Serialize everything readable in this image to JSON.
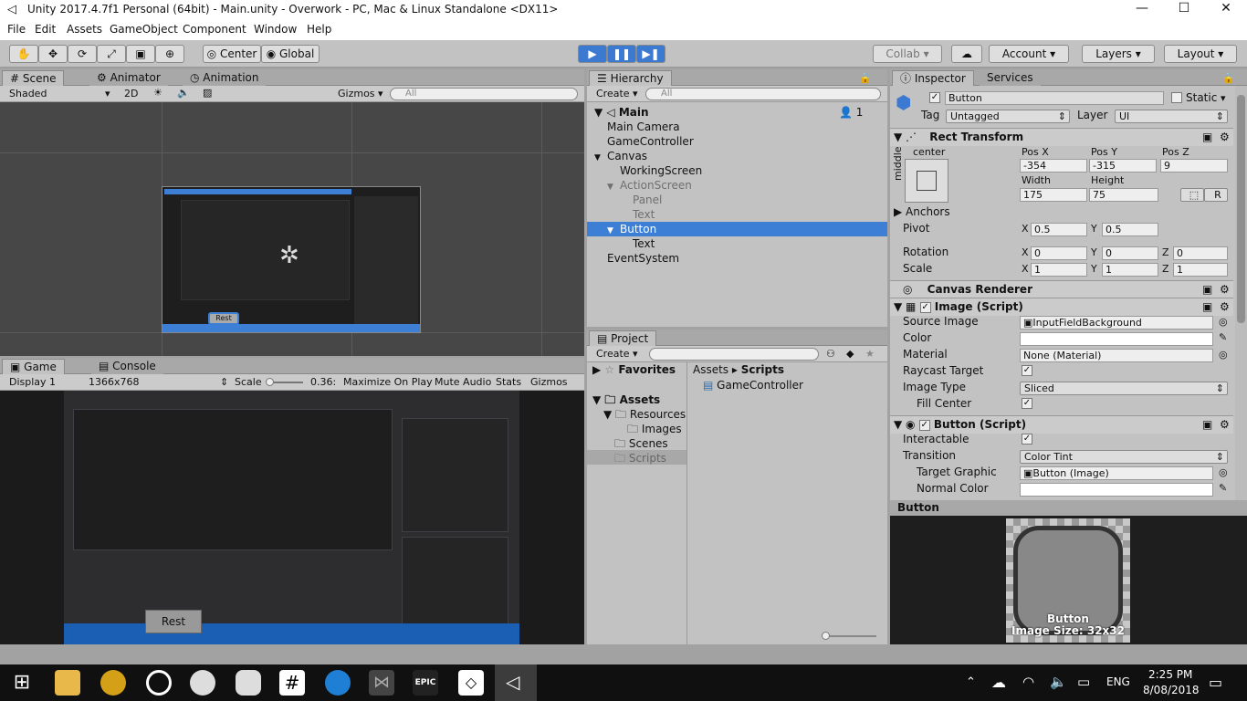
{
  "window": {
    "title": "Unity 2017.4.7f1 Personal (64bit) - Main.unity - Overwork - PC, Mac & Linux Standalone <DX11>",
    "minimize": "—",
    "maximize": "☐",
    "close": "✕"
  },
  "menu": [
    "File",
    "Edit",
    "Assets",
    "GameObject",
    "Component",
    "Window",
    "Help"
  ],
  "toolbar": {
    "center": "Center",
    "global": "Global",
    "collab": "Collab ▾",
    "account": "Account",
    "layers": "Layers",
    "layout": "Layout"
  },
  "scene": {
    "tabs": [
      "Scene",
      "Animator",
      "Animation"
    ],
    "shading": "Shaded",
    "mode2d": "2D",
    "gizmos": "Gizmos ▾",
    "search_placeholder": "All",
    "button_label": "Rest"
  },
  "game": {
    "tabs": [
      "Game",
      "Console"
    ],
    "display": "Display 1",
    "resolution": "1366x768",
    "scale_label": "Scale",
    "scale_value": "0.36:",
    "maximize": "Maximize On Play",
    "mute": "Mute Audio",
    "stats": "Stats",
    "gizmos": "Gizmos",
    "button_label": "Rest"
  },
  "hierarchy": {
    "tab": "Hierarchy",
    "create": "Create ▾",
    "search_placeholder": "All",
    "scene": "Main",
    "count": "1",
    "items": [
      {
        "label": "Main Camera",
        "indent": 0,
        "arrow": ""
      },
      {
        "label": "GameController",
        "indent": 0,
        "arrow": ""
      },
      {
        "label": "Canvas",
        "indent": 0,
        "arrow": "▼"
      },
      {
        "label": "WorkingScreen",
        "indent": 1,
        "arrow": ""
      },
      {
        "label": "ActionScreen",
        "indent": 1,
        "arrow": "▼",
        "dim": true
      },
      {
        "label": "Panel",
        "indent": 2,
        "arrow": "",
        "dim": true
      },
      {
        "label": "Text",
        "indent": 2,
        "arrow": "",
        "dim": true
      },
      {
        "label": "Button",
        "indent": 1,
        "arrow": "▼",
        "selected": true
      },
      {
        "label": "Text",
        "indent": 2,
        "arrow": ""
      },
      {
        "label": "EventSystem",
        "indent": 0,
        "arrow": ""
      }
    ]
  },
  "project": {
    "tab": "Project",
    "create": "Create ▾",
    "favorites": "Favorites",
    "assets": "Assets",
    "folders": [
      "Resources",
      "Images",
      "Scenes",
      "Scripts"
    ],
    "breadcrumb": [
      "Assets",
      "Scripts"
    ],
    "files": [
      "GameController"
    ]
  },
  "inspector": {
    "tabs": [
      "Inspector",
      "Services"
    ],
    "name": "Button",
    "static": "Static",
    "tag_label": "Tag",
    "tag": "Untagged",
    "layer_label": "Layer",
    "layer": "UI",
    "rect_transform": {
      "title": "Rect Transform",
      "anchor_h": "center",
      "anchor_v": "middle",
      "posx_label": "Pos X",
      "posy_label": "Pos Y",
      "posz_label": "Pos Z",
      "posx": "-354",
      "posy": "-315",
      "posz": "9",
      "width_label": "Width",
      "height_label": "Height",
      "width": "175",
      "height": "75",
      "r_btn": "R",
      "anchors": "Anchors",
      "pivot": "Pivot",
      "pivot_x": "0.5",
      "pivot_y": "0.5",
      "rotation": "Rotation",
      "rot_x": "0",
      "rot_y": "0",
      "rot_z": "0",
      "scale": "Scale",
      "scale_x": "1",
      "scale_y": "1",
      "scale_z": "1"
    },
    "canvas_renderer": "Canvas Renderer",
    "image": {
      "title": "Image (Script)",
      "source_label": "Source Image",
      "source": "InputFieldBackground",
      "color_label": "Color",
      "material_label": "Material",
      "material": "None (Material)",
      "raycast_label": "Raycast Target",
      "type_label": "Image Type",
      "type": "Sliced",
      "fill_label": "Fill Center"
    },
    "button": {
      "title": "Button (Script)",
      "interactable_label": "Interactable",
      "transition_label": "Transition",
      "transition": "Color Tint",
      "target_label": "Target Graphic",
      "target": "Button (Image)",
      "normal_label": "Normal Color"
    },
    "preview": {
      "title": "Button",
      "caption": "Button",
      "size": "Image Size: 32x32"
    }
  },
  "taskbar": {
    "time": "2:25 PM",
    "date": "8/08/2018",
    "lang": "ENG"
  },
  "colors": {
    "selection": "#3d7fd4",
    "unity_bg": "#c2c2c2",
    "scene_bg": "#474747"
  }
}
